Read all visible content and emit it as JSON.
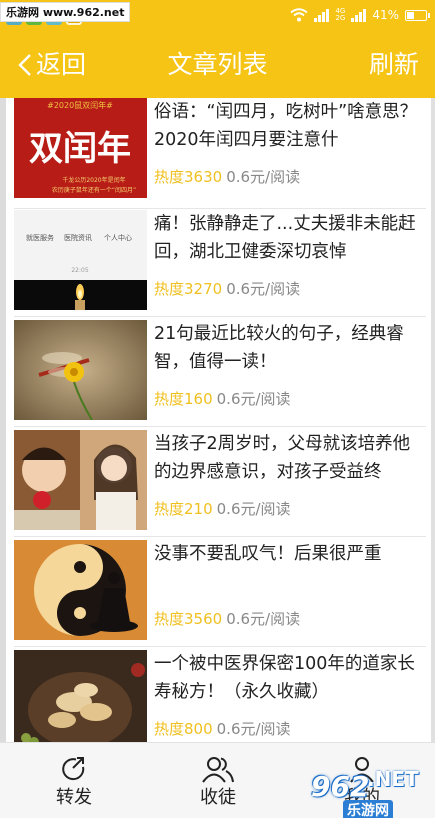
{
  "watermark": "乐游网 www.962.net",
  "status": {
    "network": [
      "4G",
      "2G"
    ],
    "battery_text": "41%",
    "battery_level": 0.41
  },
  "navbar": {
    "back_label": "返回",
    "title": "文章列表",
    "refresh_label": "刷新"
  },
  "articles": [
    {
      "title": "俗语：“闰四月，吃树叶”啥意思？2020年闰四月要注意什",
      "hot": "热度3630",
      "price": "0.6元/阅读",
      "thumb": {
        "banner": "#2020鼠双闰年#",
        "main": "双闰年",
        "sub1": "千龙公历2020年是闰年",
        "sub2": "农历庚子鼠年还有一个“闰四月”"
      }
    },
    {
      "title": "痛！张静静走了...丈夫援非未能赶回，湖北卫健委深切哀悼",
      "hot": "热度3270",
      "price": "0.6元/阅读",
      "thumb": {
        "tabs": [
          "就医服务",
          "医院资讯",
          "个人中心"
        ],
        "time": "22:05"
      }
    },
    {
      "title": "21句最近比较火的句子，经典睿智，值得一读！",
      "hot": "热度160",
      "price": "0.6元/阅读"
    },
    {
      "title": "当孩子2周岁时，父母就该培养他的边界感意识，对孩子受益终",
      "hot": "热度210",
      "price": "0.6元/阅读"
    },
    {
      "title": "没事不要乱叹气！后果很严重",
      "hot": "热度3560",
      "price": "0.6元/阅读"
    },
    {
      "title": "一个被中医界保密100年的道家长寿秘方！（永久收藏）",
      "hot": "热度800",
      "price": "0.6元/阅读"
    }
  ],
  "bottombar": {
    "share_label": "转发",
    "favorite_label": "收徒",
    "profile_label": "我的"
  },
  "brand": {
    "num": "962",
    "net": ".NET",
    "cn": "乐游网"
  },
  "colors": {
    "accent": "#f5c414",
    "hot": "#f0c020"
  }
}
